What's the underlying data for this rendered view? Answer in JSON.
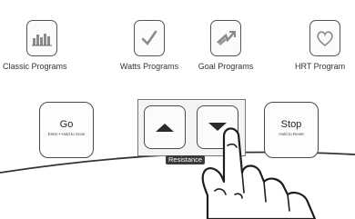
{
  "programs": [
    {
      "label": "Classic Programs",
      "icon": "bar-chart-icon"
    },
    {
      "label": "Watts Programs",
      "icon": "checkmark-icon"
    },
    {
      "label": "Goal Programs",
      "icon": "target-arrow-icon"
    },
    {
      "label": "HRT Program",
      "icon": "heart-icon"
    }
  ],
  "go_button": {
    "label": "Go",
    "sublabel": "Enter • Hold to Scan"
  },
  "stop_button": {
    "label": "Stop",
    "sublabel": "Hold to Reset"
  },
  "resistance": {
    "label": "Resistance",
    "up_icon": "up-arrow-icon",
    "down_icon": "down-arrow-icon"
  }
}
